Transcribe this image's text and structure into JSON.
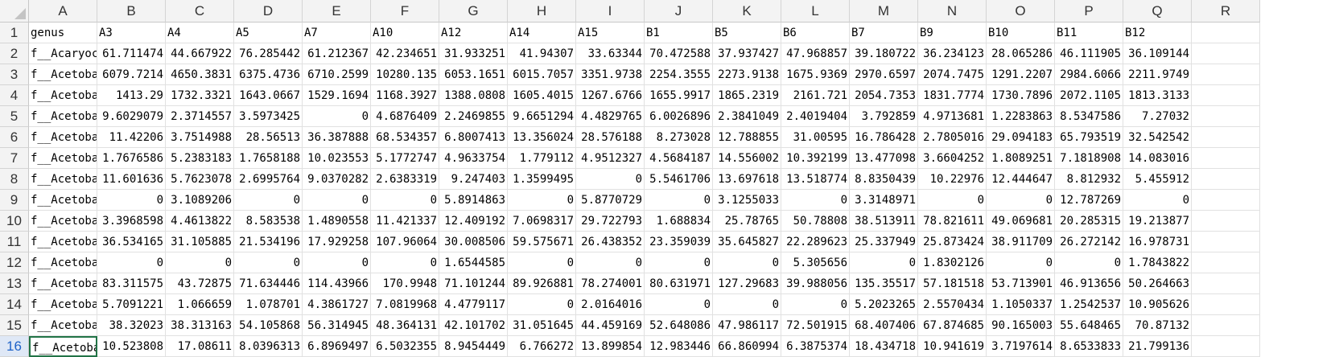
{
  "columns": [
    "A",
    "B",
    "C",
    "D",
    "E",
    "F",
    "G",
    "H",
    "I",
    "J",
    "K",
    "L",
    "M",
    "N",
    "O",
    "P",
    "Q",
    "R"
  ],
  "row_numbers": [
    "1",
    "2",
    "3",
    "4",
    "5",
    "6",
    "7",
    "8",
    "9",
    "10",
    "11",
    "12",
    "13",
    "14",
    "15",
    "16"
  ],
  "rows": [
    [
      "genus",
      "A3",
      "A4",
      "A5",
      "A7",
      "A10",
      "A12",
      "A14",
      "A15",
      "B1",
      "B5",
      "B6",
      "B7",
      "B9",
      "B10",
      "B11",
      "B12"
    ],
    [
      "f__Acaryochloridaceae",
      "61.711474",
      "44.667922",
      "76.285442",
      "61.212367",
      "42.234651",
      "31.933251",
      "41.94307",
      "33.63344",
      "70.472588",
      "37.937427",
      "47.968857",
      "39.180722",
      "36.234123",
      "28.065286",
      "46.111905",
      "36.109144"
    ],
    [
      "f__Acetobacteraceae",
      "6079.7214",
      "4650.3831",
      "6375.4736",
      "6710.2599",
      "10280.135",
      "6053.1651",
      "6015.7057",
      "3351.9738",
      "2254.3555",
      "2273.9138",
      "1675.9369",
      "2970.6597",
      "2074.7475",
      "1291.2207",
      "2984.6066",
      "2211.9749"
    ],
    [
      "f__Acetobacteraceae",
      "1413.29",
      "1732.3321",
      "1643.0667",
      "1529.1694",
      "1168.3927",
      "1388.0808",
      "1605.4015",
      "1267.6766",
      "1655.9917",
      "1865.2319",
      "2161.721",
      "2054.7353",
      "1831.7774",
      "1730.7896",
      "2072.1105",
      "1813.3133"
    ],
    [
      "f__Acetobacteraceae",
      "9.6029079",
      "2.3714557",
      "3.5973425",
      "0",
      "4.6876409",
      "2.2469855",
      "9.6651294",
      "4.4829765",
      "6.0026896",
      "2.3841049",
      "2.4019404",
      "3.792859",
      "4.9713681",
      "1.2283863",
      "8.5347586",
      "7.27032"
    ],
    [
      "f__Acetobacteraceae",
      "11.42206",
      "3.7514988",
      "28.56513",
      "36.387888",
      "68.534357",
      "6.8007413",
      "13.356024",
      "28.576188",
      "8.273028",
      "12.788855",
      "31.00595",
      "16.786428",
      "2.7805016",
      "29.094183",
      "65.793519",
      "32.542542"
    ],
    [
      "f__Acetobacteraceae",
      "1.7676586",
      "5.2383183",
      "1.7658188",
      "10.023553",
      "5.1772747",
      "4.9633754",
      "1.779112",
      "4.9512327",
      "4.5684187",
      "14.556002",
      "10.392199",
      "13.477098",
      "3.6604252",
      "1.8089251",
      "7.1818908",
      "14.083016"
    ],
    [
      "f__Acetobacteraceae",
      "11.601636",
      "5.7623078",
      "2.6995764",
      "9.0370282",
      "2.6383319",
      "9.247403",
      "1.3599495",
      "0",
      "5.5461706",
      "13.697618",
      "13.518774",
      "8.8350439",
      "10.22976",
      "12.444647",
      "8.812932",
      "5.455912"
    ],
    [
      "f__Acetobacteraceae",
      "0",
      "3.1089206",
      "0",
      "0",
      "0",
      "5.8914863",
      "0",
      "5.8770729",
      "0",
      "3.1255033",
      "0",
      "3.3148971",
      "0",
      "0",
      "12.787269",
      "0"
    ],
    [
      "f__Acetobacteraceae",
      "3.3968598",
      "4.4613822",
      "8.583538",
      "1.4890558",
      "11.421337",
      "12.409192",
      "7.0698317",
      "29.722793",
      "1.688834",
      "25.78765",
      "50.78808",
      "38.513911",
      "78.821611",
      "49.069681",
      "20.285315",
      "19.213877"
    ],
    [
      "f__Acetobacteraceae",
      "36.534165",
      "31.105885",
      "21.534196",
      "17.929258",
      "107.96064",
      "30.008506",
      "59.575671",
      "26.438352",
      "23.359039",
      "35.645827",
      "22.289623",
      "25.337949",
      "25.873424",
      "38.911709",
      "26.272142",
      "16.978731"
    ],
    [
      "f__Acetobacteraceae",
      "0",
      "0",
      "0",
      "0",
      "0",
      "1.6544585",
      "0",
      "0",
      "0",
      "0",
      "5.305656",
      "0",
      "1.8302126",
      "0",
      "0",
      "1.7843822"
    ],
    [
      "f__Acetobacteraceae",
      "83.311575",
      "43.72875",
      "71.634446",
      "114.43966",
      "170.9948",
      "71.101244",
      "89.926881",
      "78.274001",
      "80.631971",
      "127.29683",
      "39.988056",
      "135.35517",
      "57.181518",
      "53.713901",
      "46.913656",
      "50.264663"
    ],
    [
      "f__Acetobacteraceae",
      "5.7091221",
      "1.066659",
      "1.078701",
      "4.3861727",
      "7.0819968",
      "4.4779117",
      "0",
      "2.0164016",
      "0",
      "0",
      "0",
      "5.2023265",
      "2.5570434",
      "1.1050337",
      "1.2542537",
      "10.905626"
    ],
    [
      "f__Acetobacteraceae",
      "38.32023",
      "38.313163",
      "54.105868",
      "56.314945",
      "48.364131",
      "42.101702",
      "31.051645",
      "44.459169",
      "52.648086",
      "47.986117",
      "72.501915",
      "68.407406",
      "67.874685",
      "90.165003",
      "55.648465",
      "70.87132"
    ],
    [
      "f__Acetobacteraceae",
      "10.523808",
      "17.08611",
      "8.0396313",
      "6.8969497",
      "6.5032355",
      "8.9454449",
      "6.766272",
      "13.899854",
      "12.983446",
      "66.860994",
      "6.3875374",
      "18.434718",
      "10.941619",
      "3.7197614",
      "8.6533833",
      "21.799136"
    ]
  ],
  "selected_row": "16",
  "active_cell": "A16",
  "colors": {
    "header_bg": "#f3f3f3",
    "grid": "#e1e1e1",
    "active_border": "#217346",
    "selected_row_header": "#dfe8f6"
  }
}
